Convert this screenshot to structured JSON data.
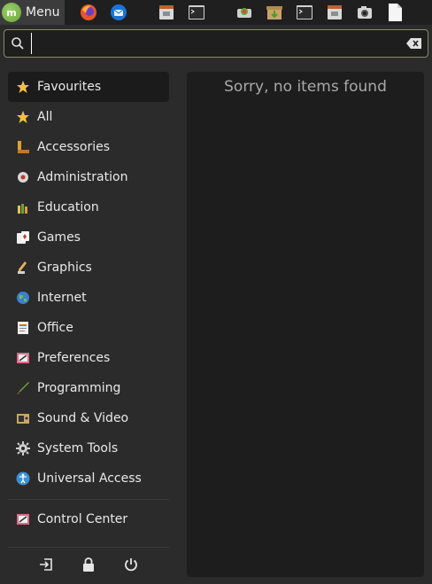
{
  "panel": {
    "menu_label": "Menu",
    "launchers": [
      "firefox-icon",
      "thunderbird-icon",
      "file-manager-icon",
      "terminal-icon",
      "software-manager-icon",
      "archive-manager-icon",
      "terminal-icon",
      "file-manager-icon",
      "screenshot-icon",
      "text-document-icon"
    ]
  },
  "search": {
    "value": "",
    "placeholder": ""
  },
  "categories": [
    {
      "label": "Favourites",
      "icon": "star-icon"
    },
    {
      "label": "All",
      "icon": "star-icon"
    },
    {
      "label": "Accessories",
      "icon": "accessories-icon"
    },
    {
      "label": "Administration",
      "icon": "administration-icon"
    },
    {
      "label": "Education",
      "icon": "education-icon"
    },
    {
      "label": "Games",
      "icon": "games-icon"
    },
    {
      "label": "Graphics",
      "icon": "graphics-icon"
    },
    {
      "label": "Internet",
      "icon": "globe-icon"
    },
    {
      "label": "Office",
      "icon": "office-icon"
    },
    {
      "label": "Preferences",
      "icon": "preferences-icon"
    },
    {
      "label": "Programming",
      "icon": "programming-icon"
    },
    {
      "label": "Sound & Video",
      "icon": "multimedia-icon"
    },
    {
      "label": "System Tools",
      "icon": "gear-icon"
    },
    {
      "label": "Universal Access",
      "icon": "accessibility-icon"
    }
  ],
  "control_center": {
    "label": "Control Center",
    "icon": "control-center-icon"
  },
  "session": [
    "logout-icon",
    "lock-icon",
    "power-icon"
  ],
  "results": {
    "message": "Sorry, no items found"
  }
}
